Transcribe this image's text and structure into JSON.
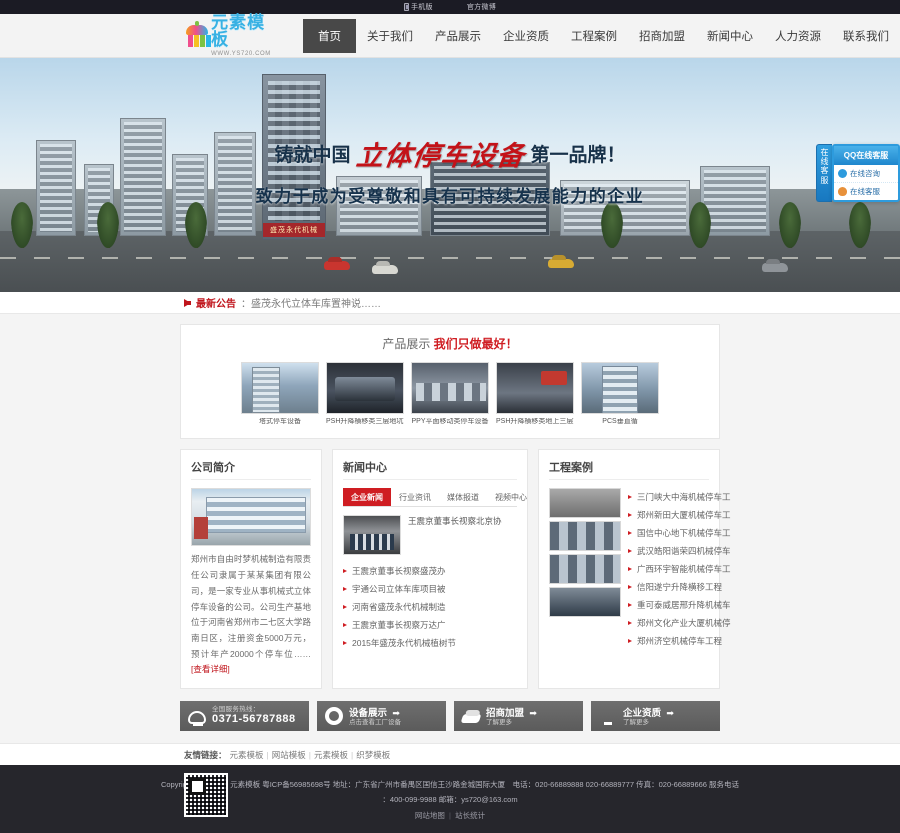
{
  "topbar": {
    "mobile": "手机版",
    "weibo": "官方微博"
  },
  "brand": {
    "title": "元素模板",
    "url": "WWW.YS720.COM"
  },
  "nav": [
    {
      "label": "首页",
      "active": true
    },
    {
      "label": "关于我们",
      "active": false
    },
    {
      "label": "产品展示",
      "active": false
    },
    {
      "label": "企业资质",
      "active": false
    },
    {
      "label": "工程案例",
      "active": false
    },
    {
      "label": "招商加盟",
      "active": false
    },
    {
      "label": "新闻中心",
      "active": false
    },
    {
      "label": "人力资源",
      "active": false
    },
    {
      "label": "联系我们",
      "active": false
    }
  ],
  "banner": {
    "line1_pre": "铸就中国",
    "line1_brush": "立体停车设备",
    "line1_post": "第一品牌！",
    "line2": "致力于成为受尊敬和具有可持续发展能力的企业",
    "tower_sign": "盛茂永代机械"
  },
  "qq": {
    "tab_label": "在线客服",
    "header": "QQ在线客服",
    "items": [
      {
        "label": "在线咨询"
      },
      {
        "label": "在线客服"
      }
    ]
  },
  "notice": {
    "label": "最新公告",
    "text": "：盛茂永代立体车库置神说……"
  },
  "products": {
    "title_a": "产品展示",
    "title_b": "我们只做最好！",
    "items": [
      {
        "caption": "塔式停车设备"
      },
      {
        "caption": "PSH升降横移类三层地坑式"
      },
      {
        "caption": "PPY平面移动类停车设备"
      },
      {
        "caption": "PSH升降横移类地上三层式"
      },
      {
        "caption": "PCS垂直循"
      }
    ]
  },
  "about": {
    "heading": "公司简介",
    "text": "郑州市自由时梦机械制造有限责任公司隶属于某某集团有限公司，是一家专业从事机械式立体停车设备的公司。公司生产基地位于河南省郑州市二七区大学路南日区，注册资金5000万元，预计年产20000个停车位……",
    "more": "[查看详细]"
  },
  "news": {
    "heading": "新闻中心",
    "tabs": [
      {
        "label": "企业新闻",
        "active": true
      },
      {
        "label": "行业资讯",
        "active": false
      },
      {
        "label": "媒体报道",
        "active": false
      },
      {
        "label": "视频中心",
        "active": false
      }
    ],
    "featured_title": "王震京董事长视察北京协",
    "items": [
      {
        "label": "王震京董事长视察盛茂办"
      },
      {
        "label": "宇通公司立体车库项目被"
      },
      {
        "label": "河南省盛茂永代机械制造"
      },
      {
        "label": "王震京董事长视察万达广"
      },
      {
        "label": "2015年盛茂永代机械植树节"
      }
    ]
  },
  "cases": {
    "heading": "工程案例",
    "items": [
      {
        "label": "三门峡大中海机械停车工"
      },
      {
        "label": "郑州新田大厦机械停车工"
      },
      {
        "label": "国信中心地下机械停车工"
      },
      {
        "label": "武汉皓阳谐荣四机械停车"
      },
      {
        "label": "广西环宇智能机械停车工"
      },
      {
        "label": "信阳遂宁升降横移工程"
      },
      {
        "label": "重可泰威居邢升降机械车"
      },
      {
        "label": "郑州文化产业大厦机械停"
      },
      {
        "label": "郑州济空机械停车工程"
      }
    ]
  },
  "action_buttons": [
    {
      "icon": "phone-icon",
      "top": "全国服务热线：",
      "main": "0371-56787888",
      "sub": "",
      "arrow": false
    },
    {
      "icon": "gear-icon",
      "top": "",
      "main": "设备展示",
      "sub": "点击查看工厂设备",
      "arrow": true
    },
    {
      "icon": "handshake-icon",
      "top": "",
      "main": "招商加盟",
      "sub": "了解更多",
      "arrow": true
    },
    {
      "icon": "trophy-icon",
      "top": "",
      "main": "企业资质",
      "sub": "了解更多",
      "arrow": true
    }
  ],
  "friend_links": {
    "label": "友情链接：",
    "items": [
      {
        "label": "元素模板"
      },
      {
        "label": "网站模板"
      },
      {
        "label": "元素模板"
      },
      {
        "label": "织梦模板"
      }
    ]
  },
  "footer": {
    "copyright_line1": "Copyright (c) 2015　元素模板 粤ICP备56985698号 地址：广东省广州市番禺区国信王沙路金城国际大厦　电话：020-66889888 020-66889777 传真：020-66889666 服务电话",
    "copyright_line2": "：400-099-9988 邮箱：ys720@163.com",
    "bottom_links": [
      {
        "label": "网站地图"
      },
      {
        "label": "站长统计"
      }
    ]
  },
  "colors": {
    "accent_red": "#cf1d22",
    "brand_blue": "#38b1e3",
    "nav_active_bg": "#484848",
    "footer_bg": "#26262c"
  }
}
